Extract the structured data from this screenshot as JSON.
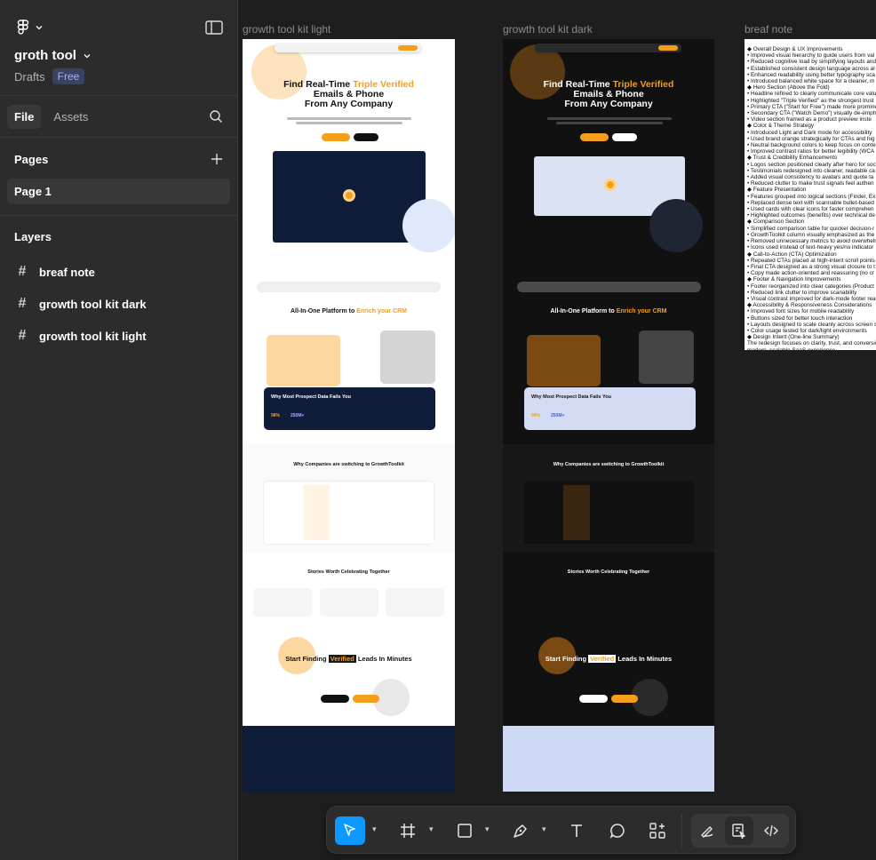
{
  "sidebar": {
    "project_title": "groth tool",
    "drafts": "Drafts",
    "plan_badge": "Free",
    "tabs": [
      "File",
      "Assets"
    ],
    "pages_heading": "Pages",
    "page_item": "Page 1",
    "layers_heading": "Layers",
    "layers": [
      "breaf note",
      "growth tool kit dark",
      "growth tool kit light"
    ]
  },
  "canvas": {
    "frame_labels": {
      "light": "growth tool kit light",
      "dark": "growth tool kit dark",
      "note": "breaf note"
    },
    "hero": {
      "line1a": "Find Real-Time ",
      "line1b": "Triple Verified",
      "line2": "Emails & Phone",
      "line3": "From Any Company"
    },
    "section_platform": {
      "prefix": "All-In-One Platform to ",
      "accent": "Enrich your CRM"
    },
    "card_data_fails": "Why Most Prospect Data Fails You",
    "stat1": "98%",
    "stat2": "250M+",
    "section_switch": "Why Companies are switching to GrowthToolkit",
    "section_stories": "Stories Worth Celebrating Together",
    "cta": {
      "prefix": "Start Finding ",
      "highlight": "Verified",
      "suffix": " Leads In Minutes"
    },
    "brief_note_lines": [
      "◆ Overall Design & UX Improvements",
      "• Improved visual hierarchy to guide users from val",
      "• Reduced cognitive load by simplifying layouts and",
      "• Established consistent design language across al",
      "• Enhanced readability using better typography sca",
      "• Introduced balanced white space for a cleaner, m",
      "◆ Hero Section (Above the Fold)",
      "• Headline refined to clearly communicate core valu",
      "• Highlighted \"Triple Verified\" as the strongest trust",
      "• Primary CTA (\"Start for Free\") made more promine",
      "• Secondary CTA (\"Watch Demo\") visually de-emph",
      "• Video section framed as a product preview inste",
      "◆ Color & Theme Strategy",
      "• Introduced Light and Dark mode for accessibility",
      "• Used brand orange strategically for CTAs and hig",
      "• Neutral background colors to keep focus on conte",
      "• Improved contrast ratios for better legibility (WCA",
      "◆ Trust & Credibility Enhancements",
      "• Logos section positioned clearly after hero for soc",
      "• Testimonials redesigned into cleaner, readable ca",
      "• Added visual consistency to avatars and quote la",
      "• Reduced clutter to make trust signals feel authen",
      "◆ Feature Presentation",
      "• Features grouped into logical sections (Finder, Ex",
      "• Replaced dense text with scannable bullet-based",
      "• Used cards with clear icons for faster comprehen",
      "• Highlighted outcomes (benefits) over technical de",
      "◆ Comparison Section",
      "• Simplified comparison table for quicker decision-r",
      "• GrowthToolkit column visually emphasized as the",
      "• Removed unnecessary metrics to avoid overwhelm",
      "• Icons used instead of text-heavy yes/no indicator",
      "◆ Call-to-Action (CTA) Optimization",
      "• Repeated CTAs placed at high-intent scroll points",
      "• Final CTA designed as a strong visual closure to t",
      "• Copy made action-oriented and reassuring (no cr",
      "◆ Footer & Navigation Improvements",
      "• Footer reorganized into clear categories (Product",
      "• Reduced link clutter to improve scanability",
      "• Visual contrast improved for dark-mode footer rea",
      "◆ Accessibility & Responsiveness Considerations",
      "• Improved font sizes for mobile readability",
      "• Buttons sized for better touch interaction",
      "• Layouts designed to scale cleanly across screen s",
      "• Color usage tested for dark/light environments",
      "◆ Design Intent (One-line Summary)",
      "The redesign focuses on clarity, trust, and conversio",
      "modern, scalable SaaS experience."
    ]
  },
  "colors": {
    "accent": "#f59e1b",
    "selection": "#0d99ff",
    "panel": "#2c2c2c",
    "canvas": "#1e1e1e"
  },
  "icons": [
    "figma-logo-icon",
    "sidebar-toggle-icon",
    "search-icon",
    "plus-icon",
    "frame-hash-icon",
    "move-pointer-icon",
    "frame-tool-icon",
    "rectangle-tool-icon",
    "pen-tool-icon",
    "text-tool-icon",
    "comment-tool-icon",
    "components-icon",
    "draw-mode-icon",
    "design-mode-icon",
    "dev-mode-icon"
  ]
}
